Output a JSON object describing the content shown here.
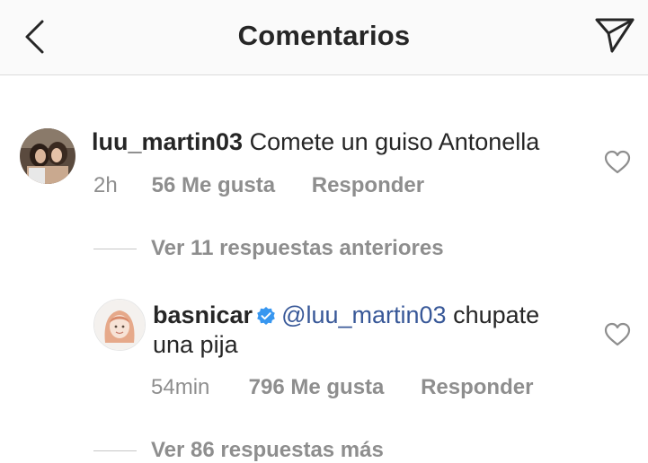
{
  "header": {
    "title": "Comentarios",
    "back_icon": "chevron-left-icon",
    "send_icon": "paper-plane-icon"
  },
  "comments": [
    {
      "username": "luu_martin03",
      "text": "Comete un guiso Antonella",
      "time": "2h",
      "likes": "56 Me gusta",
      "reply": "Responder"
    }
  ],
  "replies_link_1": {
    "label": "Ver 11 respuestas anteriores"
  },
  "reply_comment": {
    "username": "basnicar",
    "verified": true,
    "mention": "@luu_martin03",
    "text_line1": "chupate",
    "text_line2": "una pija",
    "time": "54min",
    "likes": "796 Me gusta",
    "reply": "Responder"
  },
  "replies_link_2": {
    "label": "Ver 86 respuestas más"
  },
  "colors": {
    "text": "#262626",
    "secondary": "#8e8e8e",
    "mention": "#385898",
    "verified": "#3897f0",
    "header_bg": "#fafafa"
  }
}
